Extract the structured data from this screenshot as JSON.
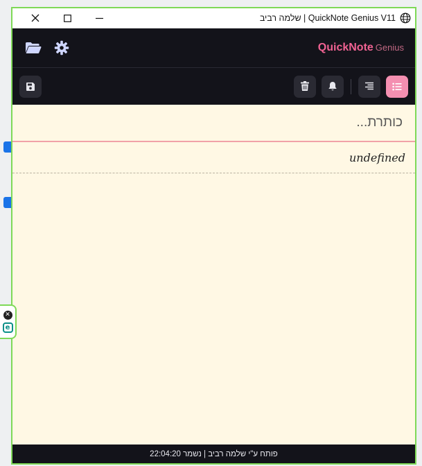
{
  "window": {
    "title": "שלמה רביב | QuickNote Genius V11",
    "minimize_label": "—",
    "close_label": "✕"
  },
  "header": {
    "brand_main": "QuickNote",
    "brand_sub": "Genius"
  },
  "note": {
    "title_placeholder": "כותרת...",
    "body_text": "undefined"
  },
  "footer": {
    "text": "פותח ע\"י שלמה רביב | נשמר 22:04:20"
  },
  "colors": {
    "accent": "#f48fb1",
    "header_bg": "#13131a",
    "paper": "#fff8e4",
    "window_border": "#7ed957"
  },
  "icons": {
    "header": [
      "folder-open-icon",
      "gear-icon"
    ],
    "toolbar_left": [
      "save-icon"
    ],
    "toolbar_right": [
      "trash-icon",
      "bell-icon",
      "align-right-icon",
      "list-icon"
    ]
  }
}
